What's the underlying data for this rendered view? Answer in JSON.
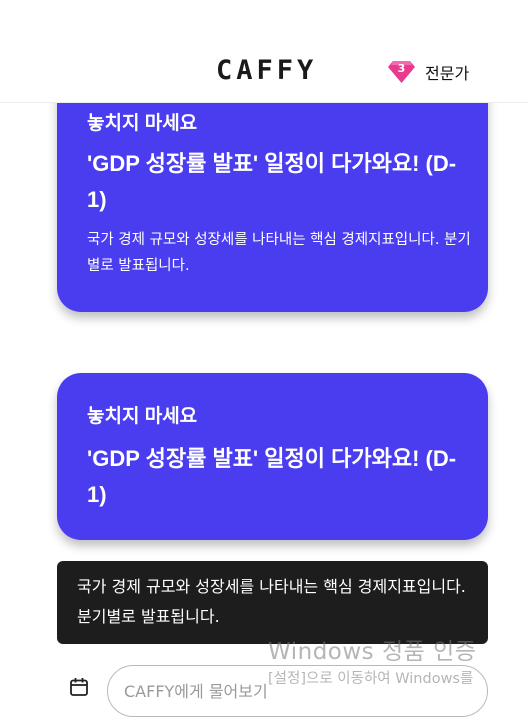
{
  "header": {
    "logo": "CAFFY",
    "badge": {
      "level": "3",
      "label": "전문가",
      "color": "#e83a8f"
    }
  },
  "cards": [
    {
      "eyebrow": "놓치지 마세요",
      "title": "'GDP 성장률 발표' 일정이 다가와요! (D-1)",
      "description": "국가 경제 규모와 성장세를 나타내는 핵심 경제지표입니다. 분기별로 발표됩니다."
    },
    {
      "eyebrow": "놓치지 마세요",
      "title": "'GDP 성장률 발표' 일정이 다가와요! (D-1)"
    }
  ],
  "tooltip": {
    "text": "국가 경제 규모와 성장세를 나타내는 핵심 경제지표입니다. 분기별로 발표됩니다."
  },
  "chat": {
    "placeholder": "CAFFY에게 물어보기",
    "calendar_icon": "calendar-icon"
  },
  "watermark": {
    "title": "Windows 정품 인증",
    "subtitle": "[설정]으로 이동하여 Windows를"
  },
  "colors": {
    "card": "#4a3df0",
    "tooltip": "#1d1d1d",
    "badge": "#e83a8f"
  }
}
